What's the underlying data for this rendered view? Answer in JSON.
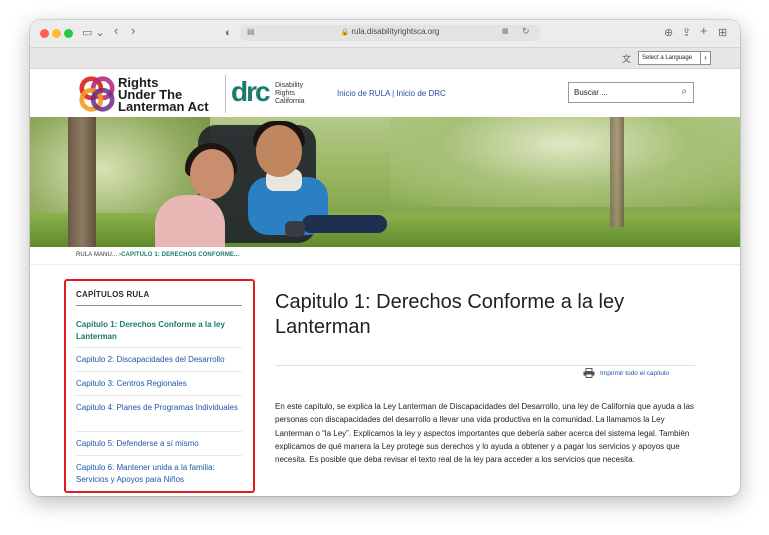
{
  "browser": {
    "url": "rula.disabilityrightsca.org"
  },
  "language_bar": {
    "select_label": "Select a Language"
  },
  "header": {
    "rula_logo_text": [
      "Rights",
      "Under The",
      "Lanterman Act"
    ],
    "drc_logo_text": "drc",
    "drc_tagline": [
      "Disability",
      "Rights",
      "California"
    ],
    "link_rula_home": "Inicio de RULA",
    "link_separator": " | ",
    "link_drc_home": "Inicio de DRC",
    "search_placeholder": "Buscar ..."
  },
  "breadcrumb": {
    "root": "RULA MANU...",
    "separator": "›",
    "current": "CAPITULO 1: DERECHOS CONFORME..."
  },
  "sidebar": {
    "title": "CAPÍTULOS RULA",
    "items": [
      {
        "label": "Capitulo 1: Derechos Conforme a la ley Lanterman",
        "active": true
      },
      {
        "label": "Capitulo 2: Discapacidades del Desarrollo",
        "active": false
      },
      {
        "label": "Capitulo 3: Centros Regionales",
        "active": false
      },
      {
        "label": "Capitulo 4: Planes de Programas Individuales",
        "active": false
      },
      {
        "label": "Capitulo 5: Defenderse a sí mismo",
        "active": false
      },
      {
        "label": "Capitulo 6: Mantener unida a la familia: Servicios y Apoyos para Niños",
        "active": false
      }
    ]
  },
  "main": {
    "title": "Capitulo 1: Derechos Conforme a la ley Lanterman",
    "print_link": "Imprimir todo el capitulo",
    "intro": "En este capítulo, se explica la Ley Lanterman de Discapacidades del Desarrollo, una ley de California que ayuda a las personas con discapacidades del desarrollo a llevar una vida productiva en la comunidad. La llamamos la Ley Lanterman o “la Ley”. Explicamos la ley y aspectos importantes que debería saber acerca del sistema legal. También explicamos de qué manera la Ley protege sus derechos y lo ayuda a obtener y a pagar los servicios y apoyos que necesita. Es posible que deba revisar el texto real de la ley para acceder a los servicios que necesita."
  },
  "colors": {
    "link_blue": "#1f57a8",
    "drc_teal": "#1a7a6c",
    "highlight_red": "#e01c1c"
  }
}
